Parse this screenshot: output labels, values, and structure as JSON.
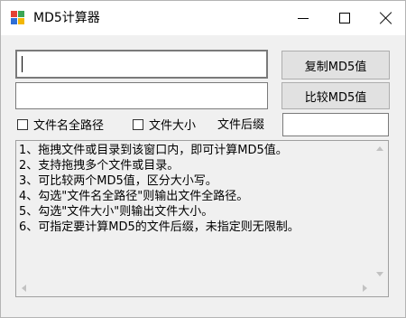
{
  "window": {
    "title": "MD5计算器",
    "icon": "app-logo-icon"
  },
  "inputs": {
    "file1_value": "",
    "file2_value": "",
    "suffix_value": ""
  },
  "buttons": {
    "copy_label": "复制MD5值",
    "compare_label": "比较MD5值"
  },
  "options": {
    "full_path_label": "文件名全路径",
    "full_path_checked": false,
    "file_size_label": "文件大小",
    "file_size_checked": false,
    "suffix_label": "文件后缀"
  },
  "help_lines": [
    "1、拖拽文件或目录到该窗口内，即可计算MD5值。",
    "2、支持拖拽多个文件或目录。",
    "3、可比较两个MD5值，区分大小写。",
    "4、勾选\"文件名全路径\"则输出文件全路径。",
    "5、勾选\"文件大小\"则输出文件大小。",
    "6、可指定要计算MD5的文件后缀，未指定则无限制。"
  ]
}
